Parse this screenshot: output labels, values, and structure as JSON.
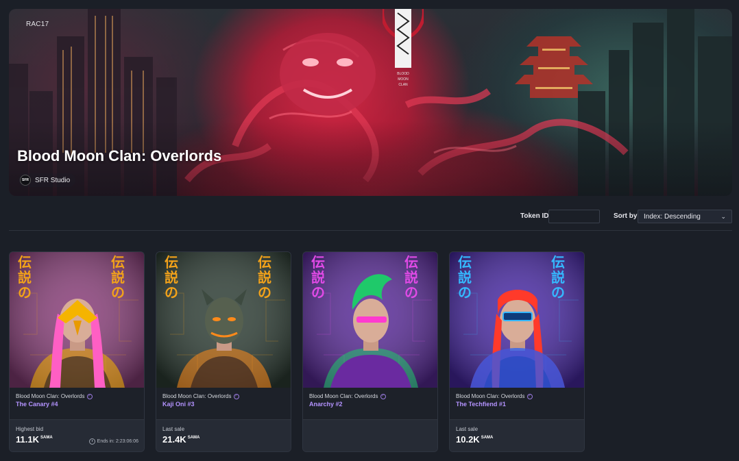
{
  "banner": {
    "code": "RAC17",
    "title": "Blood Moon Clan: Overlords",
    "creator": {
      "avatar_text": "SFR",
      "name": "SFR Studio"
    },
    "logo_text": "BLOOD MOON CLAN"
  },
  "filters": {
    "token_id_label": "Token ID",
    "token_id_value": "",
    "sort_label": "Sort by",
    "sort_value": "Index: Descending"
  },
  "cards": [
    {
      "art_text": "伝説の",
      "collection": "Blood Moon Clan: Overlords",
      "name": "The Canary #4",
      "footer_label": "Highest bid",
      "price": "11.1K",
      "currency": "SAMA",
      "ends_in": "Ends in: 2:23:06:06",
      "theme": {
        "bg": "#8a3f7a",
        "accent": "#f5b400",
        "glyph": "#f2a21a"
      }
    },
    {
      "art_text": "伝説の",
      "collection": "Blood Moon Clan: Overlords",
      "name": "Kaji Oni #3",
      "footer_label": "Last sale",
      "price": "21.4K",
      "currency": "SAMA",
      "ends_in": "",
      "theme": {
        "bg": "#2f3f36",
        "accent": "#ff8a1a",
        "glyph": "#f2a21a"
      }
    },
    {
      "art_text": "伝説の",
      "collection": "Blood Moon Clan: Overlords",
      "name": "Anarchy #2",
      "footer_label": "",
      "price": "",
      "currency": "",
      "ends_in": "",
      "theme": {
        "bg": "#5a2b9a",
        "accent": "#1fc96a",
        "glyph": "#e04ae6"
      }
    },
    {
      "art_text": "伝説の",
      "collection": "Blood Moon Clan: Overlords",
      "name": "The Techfiend #1",
      "footer_label": "Last sale",
      "price": "10.2K",
      "currency": "SAMA",
      "ends_in": "",
      "theme": {
        "bg": "#4a2aa8",
        "accent": "#ff3a2a",
        "glyph": "#35b8ff"
      }
    }
  ]
}
